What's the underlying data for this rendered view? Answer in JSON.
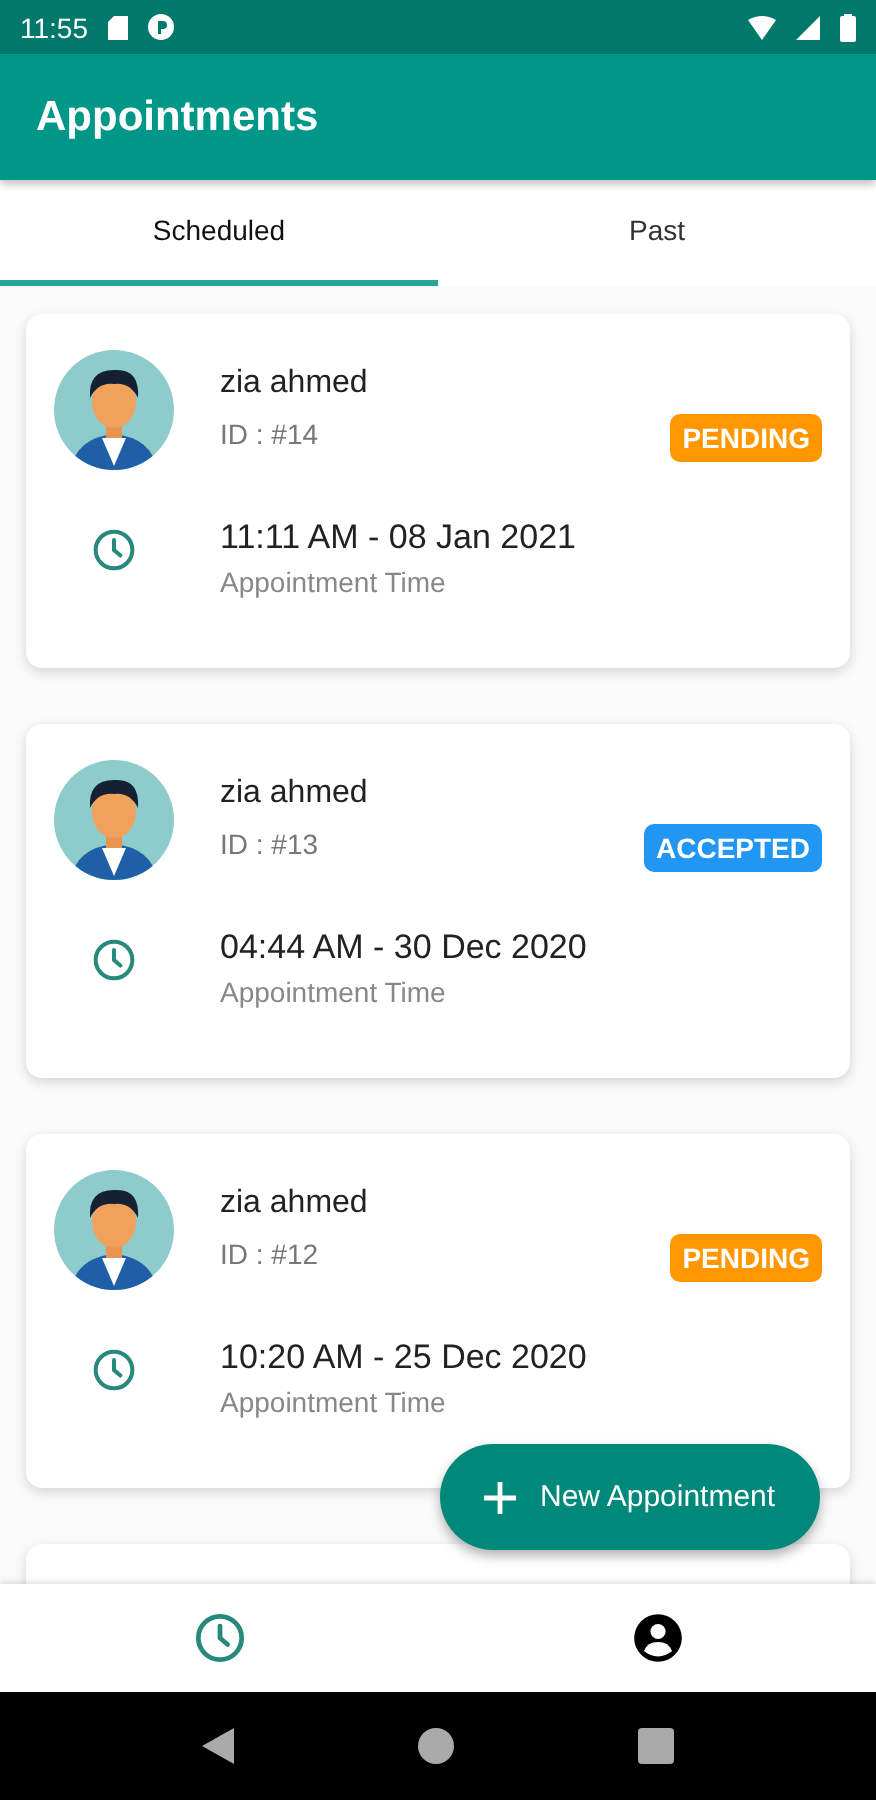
{
  "status_bar": {
    "time": "11:55"
  },
  "app_bar": {
    "title": "Appointments"
  },
  "tabs": [
    {
      "label": "Scheduled",
      "selected": true
    },
    {
      "label": "Past",
      "selected": false
    }
  ],
  "appointments": [
    {
      "name": "zia ahmed",
      "id": "ID : #14",
      "status": {
        "label": "PENDING",
        "kind": "pending"
      },
      "time": "11:11 AM - 08 Jan 2021",
      "time_label": "Appointment Time"
    },
    {
      "name": "zia ahmed",
      "id": "ID : #13",
      "status": {
        "label": "ACCEPTED",
        "kind": "accepted"
      },
      "time": "04:44 AM - 30 Dec 2020",
      "time_label": "Appointment Time"
    },
    {
      "name": "zia ahmed",
      "id": "ID : #12",
      "status": {
        "label": "PENDING",
        "kind": "pending"
      },
      "time": "10:20 AM - 25 Dec 2020",
      "time_label": "Appointment Time"
    }
  ],
  "fab": {
    "label": "New Appointment"
  },
  "bottom_nav": [
    {
      "kind": "clock",
      "selected": true
    },
    {
      "kind": "profile",
      "selected": false
    }
  ]
}
